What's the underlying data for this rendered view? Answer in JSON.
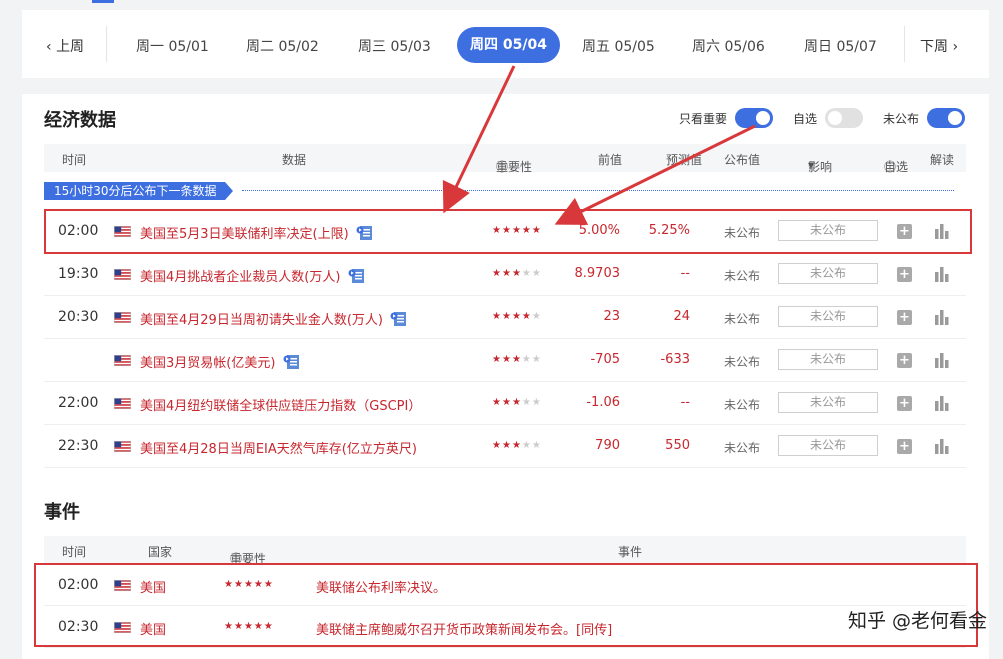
{
  "week": {
    "prev_label": "上周",
    "next_label": "下周",
    "days": [
      "周一 05/01",
      "周二 05/02",
      "周三 05/03",
      "周四 05/04",
      "周五 05/05",
      "周六 05/06",
      "周日 05/07"
    ],
    "active_index": 3
  },
  "economic": {
    "title": "经济数据",
    "toggles": [
      {
        "label": "只看重要",
        "on": true
      },
      {
        "label": "自选",
        "on": false
      },
      {
        "label": "未公布",
        "on": true
      }
    ],
    "headers": {
      "time": "时间",
      "data": "数据",
      "importance": "重要性",
      "previous": "前值",
      "forecast": "预测值",
      "published": "公布值",
      "impact": "影响",
      "watch": "自选",
      "interpret": "解读"
    },
    "notice": "15小时30分后公布下一条数据",
    "rows": [
      {
        "time": "02:00",
        "name": "美国至5月3日美联储利率决定(上限)",
        "stars": 5,
        "previous": "5.00%",
        "forecast": "5.25%",
        "published": "未公布",
        "impact": "未公布",
        "doc": true
      },
      {
        "time": "19:30",
        "name": "美国4月挑战者企业裁员人数(万人)",
        "stars": 3,
        "previous": "8.9703",
        "forecast": "--",
        "published": "未公布",
        "impact": "未公布",
        "doc": true
      },
      {
        "time": "20:30",
        "name": "美国至4月29日当周初请失业金人数(万人)",
        "stars": 4,
        "previous": "23",
        "forecast": "24",
        "published": "未公布",
        "impact": "未公布",
        "doc": true
      },
      {
        "time": "",
        "name": "美国3月贸易帐(亿美元)",
        "stars": 3,
        "previous": "-705",
        "forecast": "-633",
        "published": "未公布",
        "impact": "未公布",
        "doc": true
      },
      {
        "time": "22:00",
        "name": "美国4月纽约联储全球供应链压力指数（GSCPI）",
        "stars": 3,
        "previous": "-1.06",
        "forecast": "--",
        "published": "未公布",
        "impact": "未公布",
        "doc": false
      },
      {
        "time": "22:30",
        "name": "美国至4月28日当周EIA天然气库存(亿立方英尺)",
        "stars": 3,
        "previous": "790",
        "forecast": "550",
        "published": "未公布",
        "impact": "未公布",
        "doc": false
      }
    ]
  },
  "events": {
    "title": "事件",
    "headers": {
      "time": "时间",
      "country": "国家",
      "importance": "重要性",
      "event": "事件"
    },
    "rows": [
      {
        "time": "02:00",
        "country": "美国",
        "stars": 5,
        "name": "美联储公布利率决议。"
      },
      {
        "time": "02:30",
        "country": "美国",
        "stars": 5,
        "name": "美联储主席鲍威尔召开货币政策新闻发布会。[同传]"
      }
    ]
  },
  "watermark": "知乎 @老何看金",
  "colors": {
    "accent": "#3d6fe0",
    "data_red": "#c7272e",
    "highlight_red": "#d9383a"
  }
}
